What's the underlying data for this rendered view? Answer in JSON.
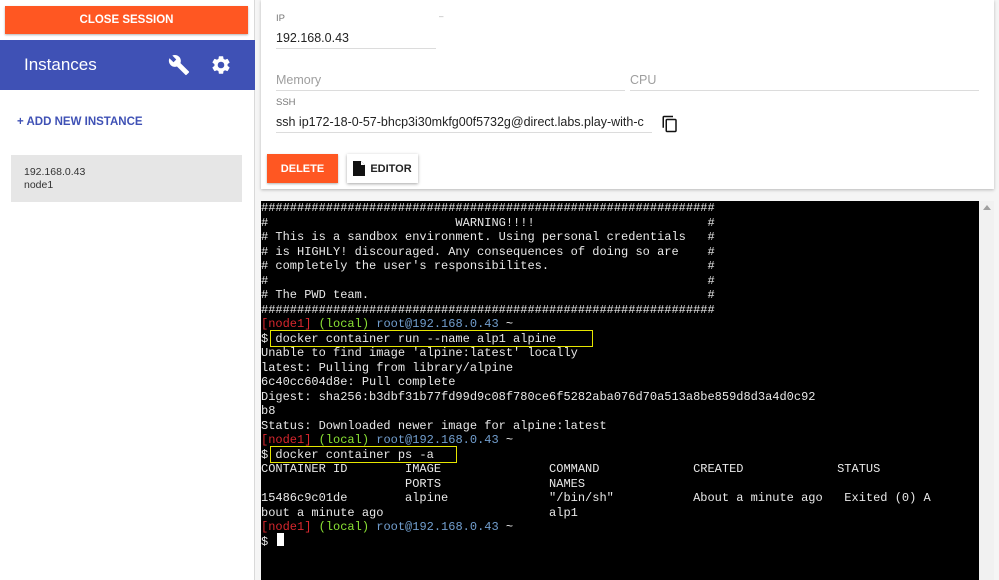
{
  "sidebar": {
    "close_session": "CLOSE SESSION",
    "title": "Instances",
    "add_instance": "+ ADD NEW INSTANCE",
    "instances": [
      {
        "ip": "192.168.0.43",
        "name": "node1"
      }
    ]
  },
  "details": {
    "ip_label": "IP",
    "ip_value": "192.168.0.43",
    "memory_placeholder": "Memory",
    "cpu_placeholder": "CPU",
    "ssh_label": "SSH",
    "ssh_value": "ssh ip172-18-0-57-bhcp3i30mkfg00f5732g@direct.labs.play-with-c",
    "delete_label": "DELETE",
    "editor_label": "EDITOR"
  },
  "terminal": {
    "banner": [
      "###############################################################",
      "#                          WARNING!!!!                        #",
      "# This is a sandbox environment. Using personal credentials   #",
      "# is HIGHLY! discouraged. Any consequences of doing so are    #",
      "# completely the user's responsibilites.                      #",
      "#                                                             #",
      "# The PWD team.                                               #",
      "###############################################################"
    ],
    "prompt": {
      "node": "[node1]",
      "local": "(local)",
      "user": "root@192.168.0.43",
      "dir": "~"
    },
    "cmd1": "$ docker container run --name alp1 alpine",
    "output1": [
      "Unable to find image 'alpine:latest' locally",
      "latest: Pulling from library/alpine",
      "6c40cc604d8e: Pull complete",
      "Digest: sha256:b3dbf31b77fd99d9c08f780ce6f5282aba076d70a513a8be859d8d3a4d0c92",
      "b8",
      "Status: Downloaded newer image for alpine:latest"
    ],
    "cmd2": "$ docker container ps -a",
    "output2": [
      "CONTAINER ID        IMAGE               COMMAND             CREATED             STATUS",
      "                    PORTS               NAMES",
      "15486c9c01de        alpine              \"/bin/sh\"           About a minute ago   Exited (0) A",
      "bout a minute ago                       alp1"
    ],
    "final_prompt": "$ "
  },
  "colors": {
    "accent": "#ff5722",
    "primary": "#3f51b5",
    "prompt_red": "#d9272e",
    "prompt_green": "#8ae234",
    "prompt_blue": "#729fcf",
    "highlight": "#e6e600"
  }
}
